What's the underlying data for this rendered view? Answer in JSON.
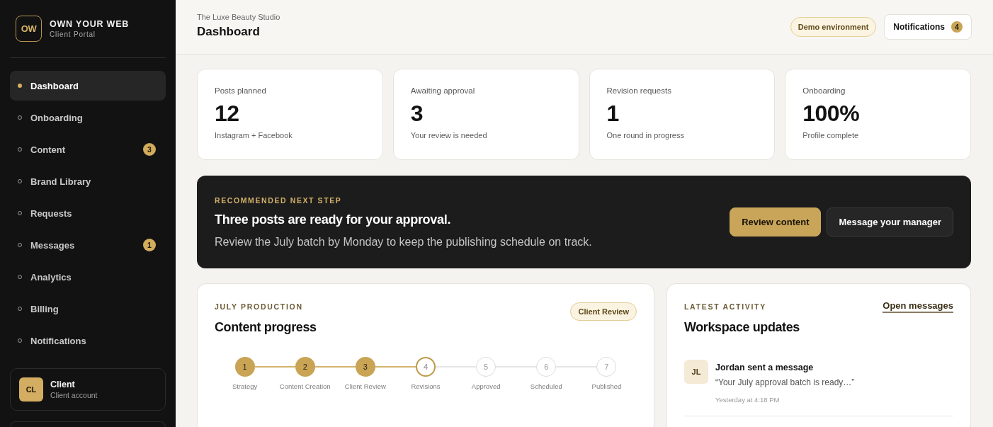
{
  "brand": {
    "logo": "OW",
    "name": "OWN YOUR WEB",
    "tagline": "Client Portal"
  },
  "sidebar": {
    "items": [
      {
        "label": "Dashboard",
        "selected": true
      },
      {
        "label": "Onboarding",
        "selected": false
      },
      {
        "label": "Content",
        "selected": false,
        "badge": "3"
      },
      {
        "label": "Brand Library",
        "selected": false
      },
      {
        "label": "Requests",
        "selected": false
      },
      {
        "label": "Messages",
        "selected": false,
        "badge": "1"
      },
      {
        "label": "Analytics",
        "selected": false
      },
      {
        "label": "Billing",
        "selected": false
      },
      {
        "label": "Notifications",
        "selected": false
      }
    ]
  },
  "user": {
    "initials": "CL",
    "name": "Client",
    "role": "Client account"
  },
  "header": {
    "subtitle": "The Luxe Beauty Studio",
    "title": "Dashboard",
    "environment": "Demo environment",
    "notifications": {
      "label": "Notifications",
      "count": "4"
    }
  },
  "stats": [
    {
      "label": "Posts planned",
      "value": "12",
      "note": "Instagram + Facebook"
    },
    {
      "label": "Awaiting approval",
      "value": "3",
      "note": "Your review is needed"
    },
    {
      "label": "Revision requests",
      "value": "1",
      "note": "One round in progress"
    },
    {
      "label": "Onboarding",
      "value": "100%",
      "note": "Profile complete"
    }
  ],
  "next_step": {
    "eyebrow": "RECOMMENDED NEXT STEP",
    "title": "Three posts are ready for your approval.",
    "text": "Review the July batch by Monday to keep the publishing schedule on track.",
    "buttons": [
      {
        "label": "Review content",
        "kind": "primary"
      },
      {
        "label": "Message your manager",
        "kind": "secondary"
      }
    ]
  },
  "production": {
    "eyebrow": "JULY PRODUCTION",
    "title": "Content progress",
    "status": "Client Review",
    "steps": [
      {
        "number": "1",
        "label": "Strategy",
        "completed": true,
        "current": false
      },
      {
        "number": "2",
        "label": "Content Creation",
        "completed": true,
        "current": false
      },
      {
        "number": "3",
        "label": "Client Review",
        "completed": true,
        "current": false
      },
      {
        "number": "4",
        "label": "Revisions",
        "completed": false,
        "current": true
      },
      {
        "number": "5",
        "label": "Approved",
        "completed": false,
        "current": false
      },
      {
        "number": "6",
        "label": "Scheduled",
        "completed": false,
        "current": false
      },
      {
        "number": "7",
        "label": "Published",
        "completed": false,
        "current": false
      }
    ]
  },
  "activity": {
    "eyebrow": "LATEST ACTIVITY",
    "title": "Workspace updates",
    "link": "Open messages",
    "items": [
      {
        "initials": "JL",
        "title": "Jordan sent a message",
        "text": "“Your July approval batch is ready…”",
        "time": "Yesterday at 4:18 PM"
      }
    ]
  }
}
